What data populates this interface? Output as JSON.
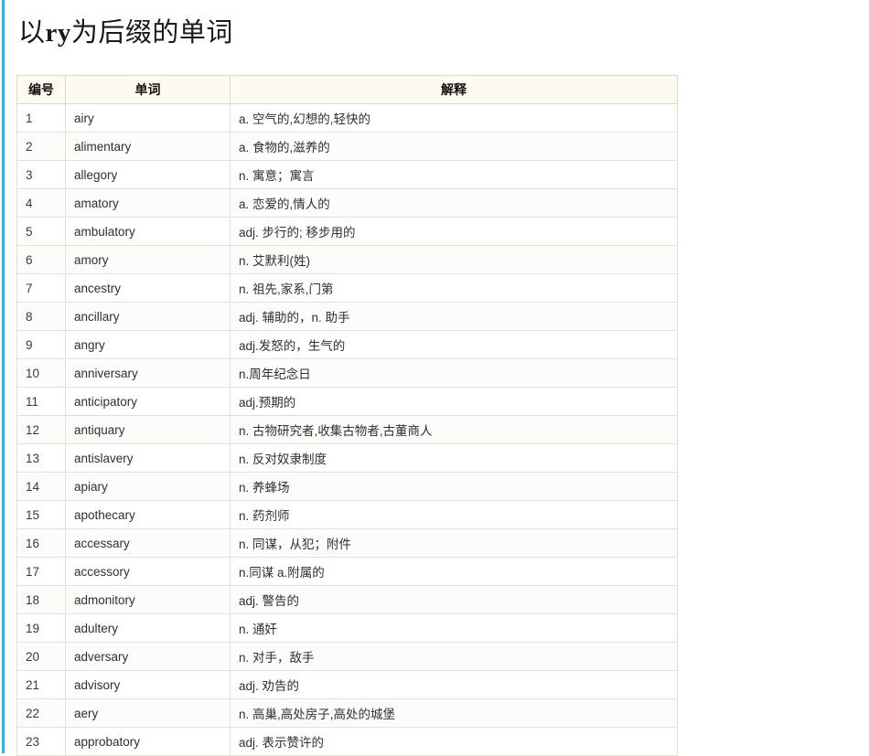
{
  "page": {
    "title_prefix": "以",
    "title_latin": "ry",
    "title_suffix": "为后缀的单词",
    "title_full": "以ry为后缀的单词",
    "accent_color": "#29b6e8",
    "header_bg_color": "#fdfaef",
    "border_color": "#dcd8cc"
  },
  "table": {
    "columns": [
      {
        "key": "no",
        "label": "编号"
      },
      {
        "key": "word",
        "label": "单词"
      },
      {
        "key": "def",
        "label": "解释"
      }
    ],
    "rows": [
      {
        "no": "1",
        "word": "airy",
        "def": "a. 空气的,幻想的,轻快的"
      },
      {
        "no": "2",
        "word": "alimentary",
        "def": "a. 食物的,滋养的"
      },
      {
        "no": "3",
        "word": "allegory",
        "def": "n. 寓意；寓言"
      },
      {
        "no": "4",
        "word": "amatory",
        "def": "a. 恋爱的,情人的"
      },
      {
        "no": "5",
        "word": "ambulatory",
        "def": "adj. 步行的; 移步用的"
      },
      {
        "no": "6",
        "word": "amory",
        "def": "n. 艾默利(姓)"
      },
      {
        "no": "7",
        "word": "ancestry",
        "def": "n. 祖先,家系,门第"
      },
      {
        "no": "8",
        "word": "ancillary",
        "def": "adj. 辅助的，n. 助手"
      },
      {
        "no": "9",
        "word": "angry",
        "def": "adj.发怒的，生气的"
      },
      {
        "no": "10",
        "word": "anniversary",
        "def": "n.周年纪念日"
      },
      {
        "no": "11",
        "word": "anticipatory",
        "def": "adj.预期的"
      },
      {
        "no": "12",
        "word": "antiquary",
        "def": "n. 古物研究者,收集古物者,古董商人"
      },
      {
        "no": "13",
        "word": "antislavery",
        "def": "n. 反对奴隶制度"
      },
      {
        "no": "14",
        "word": "apiary",
        "def": "n. 养蜂场"
      },
      {
        "no": "15",
        "word": "apothecary",
        "def": "n. 药剂师"
      },
      {
        "no": "16",
        "word": "accessary",
        "def": "n. 同谋，从犯；附件"
      },
      {
        "no": "17",
        "word": "accessory",
        "def": "n.同谋 a.附属的"
      },
      {
        "no": "18",
        "word": "admonitory",
        "def": "adj. 警告的"
      },
      {
        "no": "19",
        "word": "adultery",
        "def": "n. 通奸"
      },
      {
        "no": "20",
        "word": "adversary",
        "def": "n. 对手，敌手"
      },
      {
        "no": "21",
        "word": "advisory",
        "def": "adj. 劝告的"
      },
      {
        "no": "22",
        "word": "aery",
        "def": "n. 高巢,高处房子,高处的城堡"
      },
      {
        "no": "23",
        "word": "approbatory",
        "def": "adj. 表示赞许的"
      }
    ]
  }
}
